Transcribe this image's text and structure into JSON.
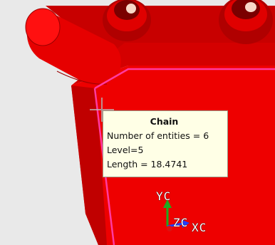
{
  "colors": {
    "background": "#e8e8e8",
    "part_red": "#ee0000",
    "part_shadow": "#b80000",
    "part_dark": "#8a0000",
    "highlight_chain": "#ff3aa0",
    "tooltip_bg": "#ffffe6",
    "axis_x": "#1f3fff",
    "axis_y": "#1faa1f",
    "axis_z": "#dd1111"
  },
  "tooltip": {
    "title": "Chain",
    "lines": [
      "Number of entities = 6",
      "Level=5",
      "Length = 18.4741"
    ]
  },
  "triad": {
    "y_label": "YC",
    "z_label": "ZC",
    "x_label": "XC"
  },
  "cursor": {
    "icon": "crosshair-icon"
  }
}
